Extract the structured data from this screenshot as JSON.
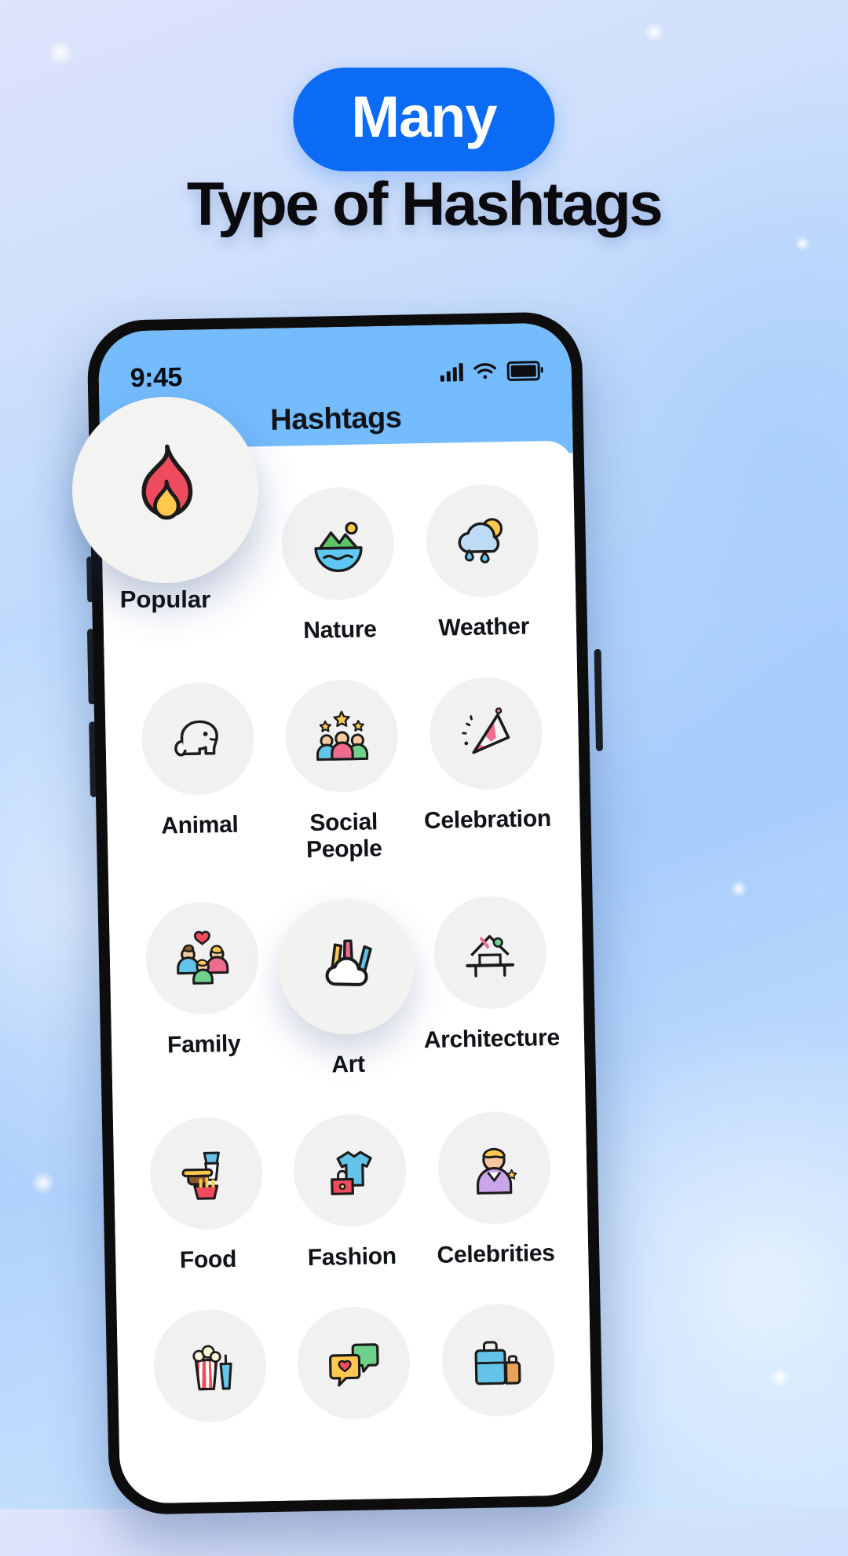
{
  "promo": {
    "badge": "Many",
    "headline": "Type of Hashtags",
    "badge_color": "#0b6bf5",
    "headline_color": "#0b0b0f"
  },
  "phone": {
    "status": {
      "time": "9:45",
      "signal_icon": "signal-bars-icon",
      "wifi_icon": "wifi-icon",
      "battery_icon": "battery-full-icon"
    },
    "appbar": {
      "title": "Hashtags",
      "background": "#74bcfd"
    }
  },
  "categories": [
    {
      "label": "Popular",
      "icon": "flame-icon",
      "floating": true
    },
    {
      "label": "Nature",
      "icon": "nature-icon",
      "floating": false
    },
    {
      "label": "Weather",
      "icon": "weather-icon",
      "floating": false
    },
    {
      "label": "Animal",
      "icon": "elephant-icon",
      "floating": false
    },
    {
      "label": "Social People",
      "icon": "people-icon",
      "floating": false
    },
    {
      "label": "Celebration",
      "icon": "party-hat-icon",
      "floating": false
    },
    {
      "label": "Family",
      "icon": "family-icon",
      "floating": false
    },
    {
      "label": "Art",
      "icon": "art-icon",
      "floating": true
    },
    {
      "label": "Architecture",
      "icon": "architecture-icon",
      "floating": false
    },
    {
      "label": "Food",
      "icon": "food-icon",
      "floating": false
    },
    {
      "label": "Fashion",
      "icon": "fashion-icon",
      "floating": false
    },
    {
      "label": "Celebrities",
      "icon": "celebrity-icon",
      "floating": false
    },
    {
      "label": "",
      "icon": "popcorn-icon",
      "floating": false
    },
    {
      "label": "",
      "icon": "chat-icon",
      "floating": false
    },
    {
      "label": "",
      "icon": "travel-icon",
      "floating": false
    }
  ],
  "theme": {
    "tile_background": "#f1f1f1",
    "label_color": "#101318",
    "screen_background": "#ffffff"
  }
}
